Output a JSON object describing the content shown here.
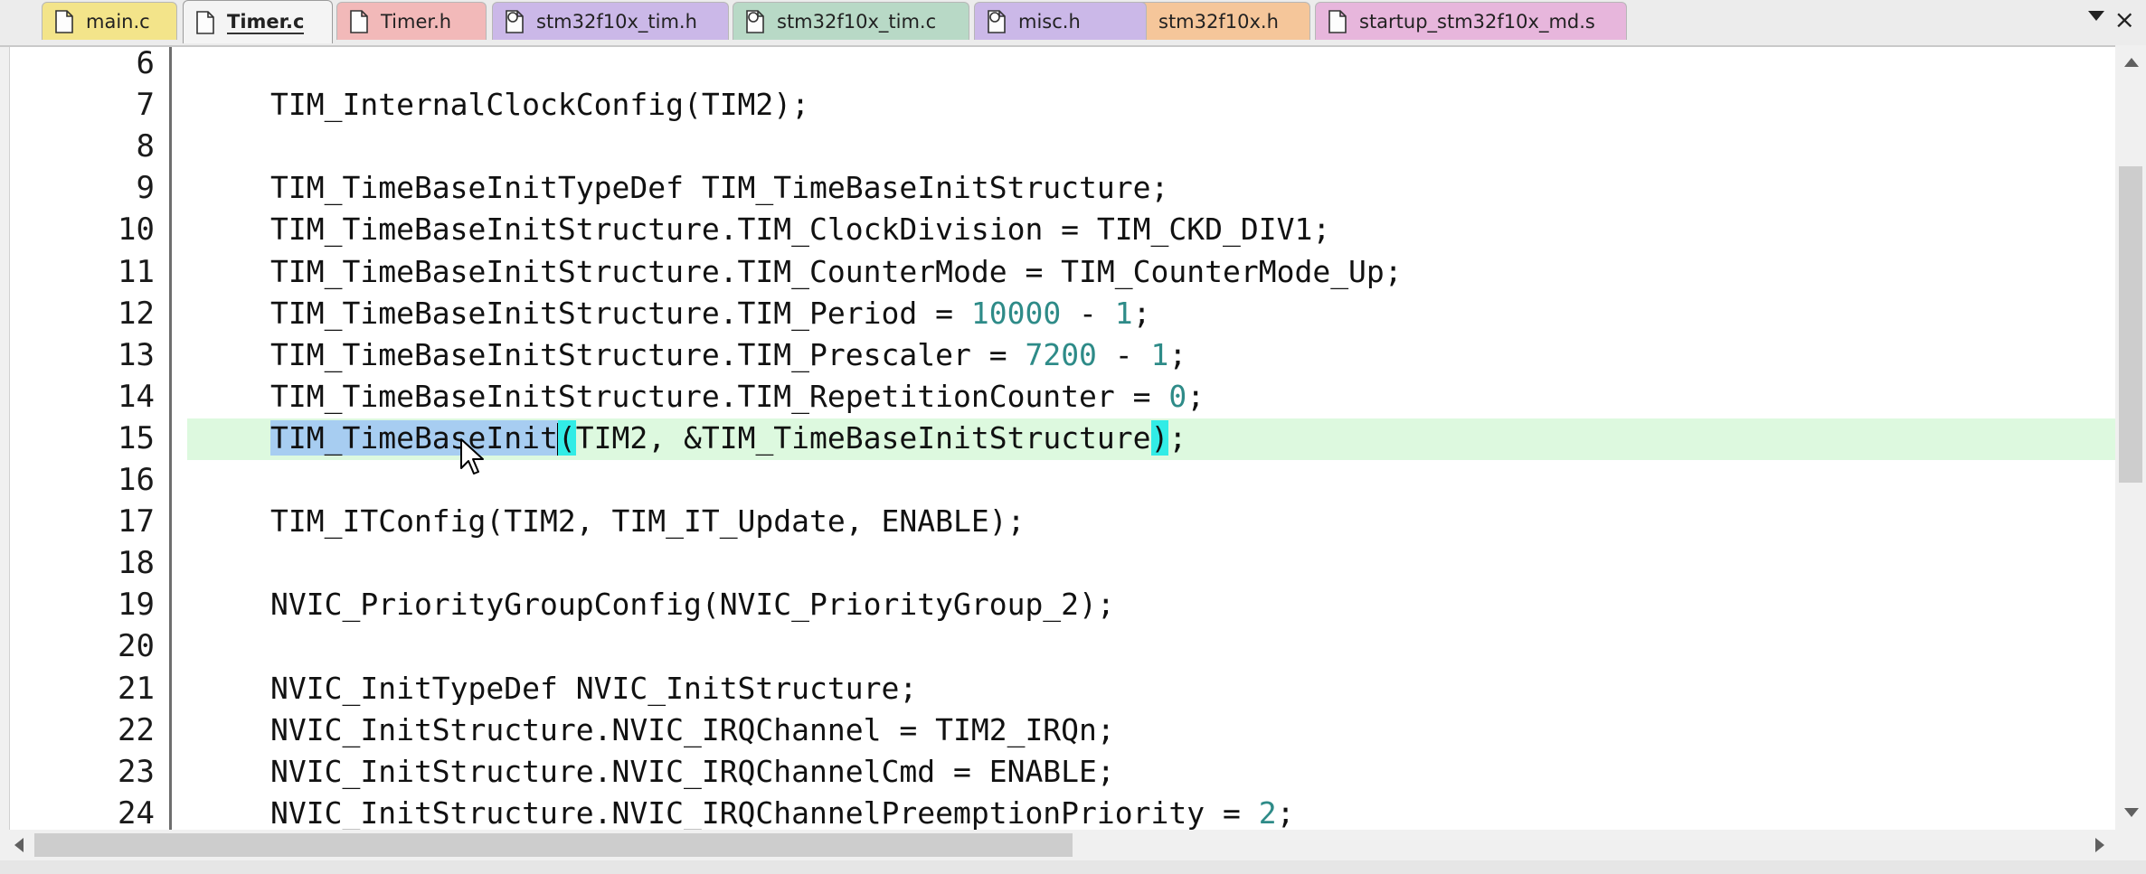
{
  "tabs": [
    {
      "label": "main.c",
      "color": "#f3e48a",
      "icon": "c-file-icon",
      "active": false
    },
    {
      "label": "Timer.c",
      "color": "#f4f4f4",
      "icon": "c-file-icon",
      "active": true
    },
    {
      "label": "Timer.h",
      "color": "#f2b9b9",
      "icon": "h-file-icon",
      "active": false
    },
    {
      "label": "stm32f10x_tim.h",
      "color": "#cbb8e8",
      "icon": "library-header-icon",
      "active": false
    },
    {
      "label": "stm32f10x_tim.c",
      "color": "#b8d9c6",
      "icon": "library-source-icon",
      "active": false
    },
    {
      "label": "misc.h",
      "color": "#cbb8e8",
      "icon": "library-header-icon",
      "active": false
    },
    {
      "label": "stm32f10x.h",
      "color": "#f5c69a",
      "icon": "header-file-icon",
      "active": false
    },
    {
      "label": "startup_stm32f10x_md.s",
      "color": "#e7b6dc",
      "icon": "asm-file-icon",
      "active": false
    }
  ],
  "tab_menu": {
    "icon": "chevron-down-icon",
    "close_label": "×"
  },
  "editor": {
    "lines": [
      {
        "num": "6",
        "parts": [
          {
            "t": ""
          }
        ]
      },
      {
        "num": "7",
        "parts": [
          {
            "t": "TIM_InternalClockConfig(TIM2);"
          }
        ]
      },
      {
        "num": "8",
        "parts": [
          {
            "t": ""
          }
        ]
      },
      {
        "num": "9",
        "parts": [
          {
            "t": "TIM_TimeBaseInitTypeDef TIM_TimeBaseInitStructure;"
          }
        ]
      },
      {
        "num": "10",
        "parts": [
          {
            "t": "TIM_TimeBaseInitStructure.TIM_ClockDivision = TIM_CKD_DIV1;"
          }
        ]
      },
      {
        "num": "11",
        "parts": [
          {
            "t": "TIM_TimeBaseInitStructure.TIM_CounterMode = TIM_CounterMode_Up;"
          }
        ]
      },
      {
        "num": "12",
        "parts": [
          {
            "t": "TIM_TimeBaseInitStructure.TIM_Period = "
          },
          {
            "t": "10000",
            "c": "n"
          },
          {
            "t": " - "
          },
          {
            "t": "1",
            "c": "n"
          },
          {
            "t": ";"
          }
        ]
      },
      {
        "num": "13",
        "parts": [
          {
            "t": "TIM_TimeBaseInitStructure.TIM_Prescaler = "
          },
          {
            "t": "7200",
            "c": "n"
          },
          {
            "t": " - "
          },
          {
            "t": "1",
            "c": "n"
          },
          {
            "t": ";"
          }
        ]
      },
      {
        "num": "14",
        "parts": [
          {
            "t": "TIM_TimeBaseInitStructure.TIM_RepetitionCounter = "
          },
          {
            "t": "0",
            "c": "n"
          },
          {
            "t": ";"
          }
        ]
      },
      {
        "num": "15",
        "highlight": true,
        "parts": [
          {
            "t": "TIM_TimeBaseInit",
            "c": "sel"
          },
          {
            "caret": true
          },
          {
            "t": "(",
            "c": "br"
          },
          {
            "t": "TIM2, &TIM_TimeBaseInitStructure"
          },
          {
            "t": ")",
            "c": "br"
          },
          {
            "t": ";"
          }
        ]
      },
      {
        "num": "16",
        "parts": [
          {
            "t": ""
          }
        ]
      },
      {
        "num": "17",
        "parts": [
          {
            "t": "TIM_ITConfig(TIM2, TIM_IT_Update, ENABLE);"
          }
        ]
      },
      {
        "num": "18",
        "parts": [
          {
            "t": ""
          }
        ]
      },
      {
        "num": "19",
        "parts": [
          {
            "t": "NVIC_PriorityGroupConfig(NVIC_PriorityGroup_2);"
          }
        ]
      },
      {
        "num": "20",
        "parts": [
          {
            "t": ""
          }
        ]
      },
      {
        "num": "21",
        "parts": [
          {
            "t": "NVIC_InitTypeDef NVIC_InitStructure;"
          }
        ]
      },
      {
        "num": "22",
        "parts": [
          {
            "t": "NVIC_InitStructure.NVIC_IRQChannel = TIM2_IRQn;"
          }
        ]
      },
      {
        "num": "23",
        "parts": [
          {
            "t": "NVIC_InitStructure.NVIC_IRQChannelCmd = ENABLE;"
          }
        ]
      },
      {
        "num": "24",
        "parts": [
          {
            "t": "NVIC_InitStructure.NVIC_IRQChannelPreemptionPriority = "
          },
          {
            "t": "2",
            "c": "n"
          },
          {
            "t": ";"
          }
        ]
      }
    ]
  },
  "scrollbars": {
    "vertical": {
      "icon_up": "scroll-up-arrow-icon",
      "icon_down": "scroll-down-arrow-icon"
    },
    "horizontal": {
      "icon_left": "scroll-left-arrow-icon",
      "icon_right": "scroll-right-arrow-icon"
    }
  }
}
